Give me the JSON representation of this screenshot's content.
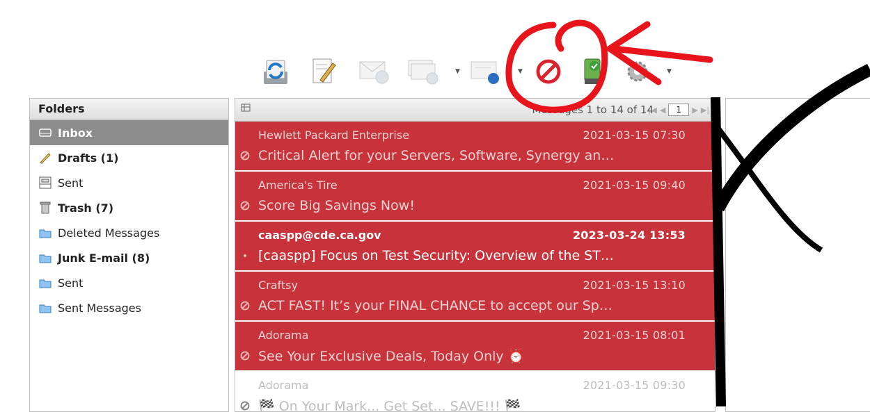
{
  "toolbar": {
    "buttons": [
      "refresh-icon",
      "compose-icon",
      "reply-icon",
      "reply-all-icon",
      "forward-icon",
      "mark-junk-icon",
      "not-junk-icon",
      "settings-icon"
    ],
    "junk_color": "#d9232e"
  },
  "folders": {
    "title": "Folders",
    "items": [
      {
        "label": "Inbox",
        "icon": "inbox-icon"
      },
      {
        "label": "Drafts (1)",
        "icon": "pencil-icon"
      },
      {
        "label": "Sent",
        "icon": "sent-tray-icon"
      },
      {
        "label": "Trash (7)",
        "icon": "trash-icon"
      },
      {
        "label": "Deleted Messages",
        "icon": "folder-icon"
      },
      {
        "label": "Junk E-mail (8)",
        "icon": "folder-icon"
      },
      {
        "label": "Sent",
        "icon": "folder-icon"
      },
      {
        "label": "Sent Messages",
        "icon": "folder-icon"
      }
    ]
  },
  "messages": {
    "count_label": "Messages 1 to 14 of 14",
    "page": "1",
    "rows": [
      {
        "sender": "Hewlett Packard Enterprise",
        "date": "2021-03-15 07:30",
        "subject": "Critical Alert for your Servers, Software, Synergy an…"
      },
      {
        "sender": "America's Tire",
        "date": "2021-03-15 09:40",
        "subject": "Score Big Savings Now!"
      },
      {
        "sender": "caaspp@cde.ca.gov",
        "date": "2023-03-24 13:53",
        "subject": "[caaspp] Focus on Test Security: Overview of the ST…"
      },
      {
        "sender": "Craftsy",
        "date": "2021-03-15 13:10",
        "subject": "ACT FAST! It’s your FINAL CHANCE to accept our Sp…"
      },
      {
        "sender": "Adorama",
        "date": "2021-03-15 08:01",
        "subject": "See Your Exclusive Deals, Today Only ⏰"
      },
      {
        "sender": "Adorama",
        "date": "2021-03-15 09:30",
        "subject": "🏁 On Your Mark... Get Set... SAVE!!! 🏁"
      }
    ]
  },
  "annotation": {
    "color": "#e8141c"
  }
}
